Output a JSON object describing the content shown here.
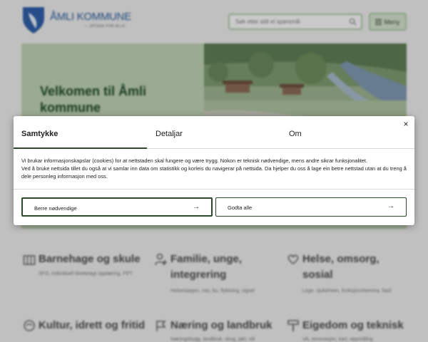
{
  "header": {
    "logo_text": "ÅMLI KOMMUNE",
    "logo_subtitle": "— SPISSA FOR ALLE",
    "search_placeholder": "Søk etter stilt et spørsmål",
    "menu_label": "Meny"
  },
  "hero": {
    "title": "Velkomen til Åmli kommune"
  },
  "categories": [
    {
      "title": "Barnehage og skule",
      "subtitle": "SFO, individuell tilrettelagt opplæring, PPT",
      "icon": "school-icon"
    },
    {
      "title": "Familie, unge, integrering",
      "subtitle": "Helsestasjon, nav, bu, flyktning, vigsel",
      "icon": "family-icon"
    },
    {
      "title": "Helse, omsorg, sosial",
      "subtitle": "Lege, sjukeheim, funksjonshemma, fastl",
      "icon": "heart-hand-icon"
    },
    {
      "title": "Kultur, idrett og fritid",
      "subtitle": "",
      "icon": "culture-icon"
    },
    {
      "title": "Næring og landbruk",
      "subtitle": "Næringsbygg, landbruk, skog, jakt, vilt",
      "icon": "flag-icon"
    },
    {
      "title": "Eigedom og teknisk",
      "subtitle": "VA, renovasjon, kart, oppmåling",
      "icon": "tools-icon"
    }
  ],
  "dialog": {
    "tabs": [
      "Samtykke",
      "Detaljar",
      "Om"
    ],
    "active_tab": "Samtykke",
    "text_line1": "Vi brukar informasjonskapslar (cookies) for at nettstaden skal fungere og være trygg. Nokon er teknisk nødvendige, mens andre sikrar funksjonalitet.",
    "text_line2": "Ved å bruke nettsida tillet du også at vi samlar inn data om statistikk og korleis du navigerar på nettsida. Da hjelper du oss å lage ein betre nettstad utan at du treng å dele personleg informasjon med oss.",
    "button_necessary": "Berre nødvendige",
    "button_accept_all": "Godta alle",
    "arrow_glyph": "→",
    "close_glyph": "×"
  },
  "colors": {
    "accent_dark_green": "#2b4a2b",
    "hero_green": "#bdd0b3",
    "brand_blue": "#2d5a9a"
  }
}
